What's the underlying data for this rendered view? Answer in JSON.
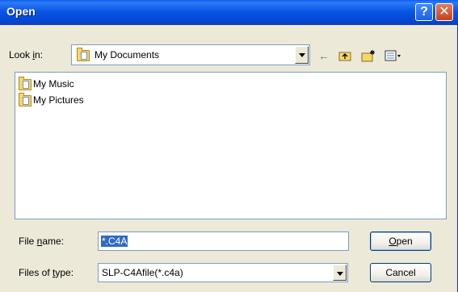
{
  "window": {
    "title": "Open",
    "help_glyph": "?",
    "close_glyph": "✕"
  },
  "lookin": {
    "label_pre": "Look ",
    "label_accel": "i",
    "label_post": "n:",
    "value": "My Documents",
    "icon": "my-documents-icon"
  },
  "toolbar": {
    "back_icon": "←",
    "up_icon": "up-folder-icon",
    "new_folder_icon": "new-folder-icon",
    "view_menu_icon": "view-menu-icon"
  },
  "files": [
    {
      "name": "My Music",
      "icon": "music-folder-icon"
    },
    {
      "name": "My Pictures",
      "icon": "pictures-folder-icon"
    }
  ],
  "filename": {
    "label_pre": "File ",
    "label_accel": "n",
    "label_post": "ame:",
    "value": "*.C4A"
  },
  "filetype": {
    "label_pre": "Files of ",
    "label_accel": "t",
    "label_post": "ype:",
    "value": "SLP-C4Afile(*.c4a)"
  },
  "buttons": {
    "open_accel": "O",
    "open_rest": "pen",
    "cancel": "Cancel"
  },
  "colors": {
    "titlebar": "#0856e4",
    "selection": "#316ac5",
    "face": "#ece9d8"
  }
}
